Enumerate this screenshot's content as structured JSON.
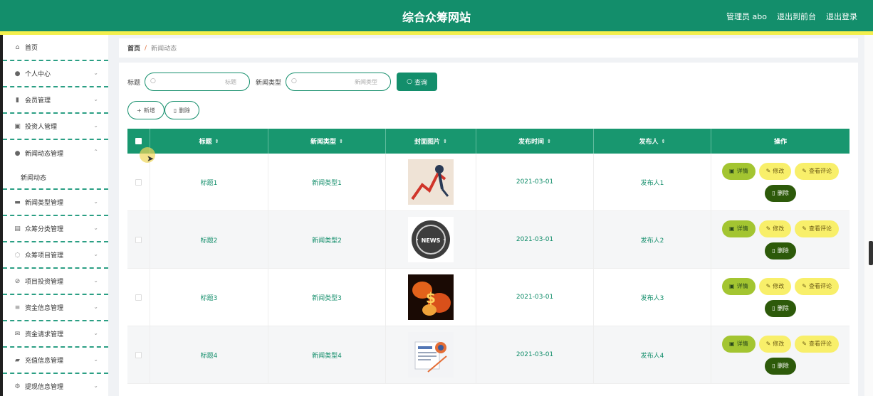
{
  "header": {
    "title": "综合众筹网站",
    "admin": "管理员 abo",
    "back_front": "退出到前台",
    "logout": "退出登录"
  },
  "sidebar": {
    "items": [
      {
        "label": "首页",
        "icon": "home-icon",
        "chevron": false
      },
      {
        "label": "个人中心",
        "icon": "user-icon",
        "chevron": true
      },
      {
        "label": "会员管理",
        "icon": "chart-icon",
        "chevron": true
      },
      {
        "label": "投资人管理",
        "icon": "doc-icon",
        "chevron": true
      },
      {
        "label": "新闻动态管理",
        "icon": "user-icon",
        "chevron": true,
        "expanded": true
      },
      {
        "label": "新闻类型管理",
        "icon": "message-icon",
        "chevron": true
      },
      {
        "label": "众筹分类管理",
        "icon": "clipboard-icon",
        "chevron": true
      },
      {
        "label": "众筹项目管理",
        "icon": "power-icon",
        "chevron": true
      },
      {
        "label": "项目投资管理",
        "icon": "slash-icon",
        "chevron": true
      },
      {
        "label": "资金信息管理",
        "icon": "list-icon",
        "chevron": true
      },
      {
        "label": "资金请求管理",
        "icon": "mail-icon",
        "chevron": true
      },
      {
        "label": "充值信息管理",
        "icon": "bag-icon",
        "chevron": true
      },
      {
        "label": "提现信息管理",
        "icon": "cog-icon",
        "chevron": true
      }
    ],
    "sub_item": "新闻动态"
  },
  "breadcrumb": {
    "home": "首页",
    "sep": "/",
    "current": "新闻动态"
  },
  "search": {
    "title_label": "标题",
    "title_placeholder": "标题",
    "type_label": "新闻类型",
    "type_placeholder": "新闻类型",
    "button": "查询"
  },
  "actions": {
    "add": "新增",
    "delete": "删除"
  },
  "table": {
    "headers": [
      "标题",
      "新闻类型",
      "封面图片",
      "发布时间",
      "发布人",
      "操作"
    ],
    "rows": [
      {
        "title": "标题1",
        "type": "新闻类型1",
        "date": "2021-03-01",
        "author": "发布人1",
        "cover": "stock-arrow"
      },
      {
        "title": "标题2",
        "type": "新闻类型2",
        "date": "2021-03-01",
        "author": "发布人2",
        "cover": "news-globe"
      },
      {
        "title": "标题3",
        "type": "新闻类型3",
        "date": "2021-03-01",
        "author": "发布人3",
        "cover": "fire-dollar"
      },
      {
        "title": "标题4",
        "type": "新闻类型4",
        "date": "2021-03-01",
        "author": "发布人4",
        "cover": "newspaper"
      }
    ],
    "ops": {
      "detail": "详情",
      "edit": "修改",
      "review": "查看评论",
      "delete": "删除"
    }
  },
  "colors": {
    "primary": "#138e6b",
    "stripe": "#f3ef4d",
    "detail": "#a3c531",
    "edit": "#f8ef6a",
    "delete": "#2d5a0a"
  }
}
